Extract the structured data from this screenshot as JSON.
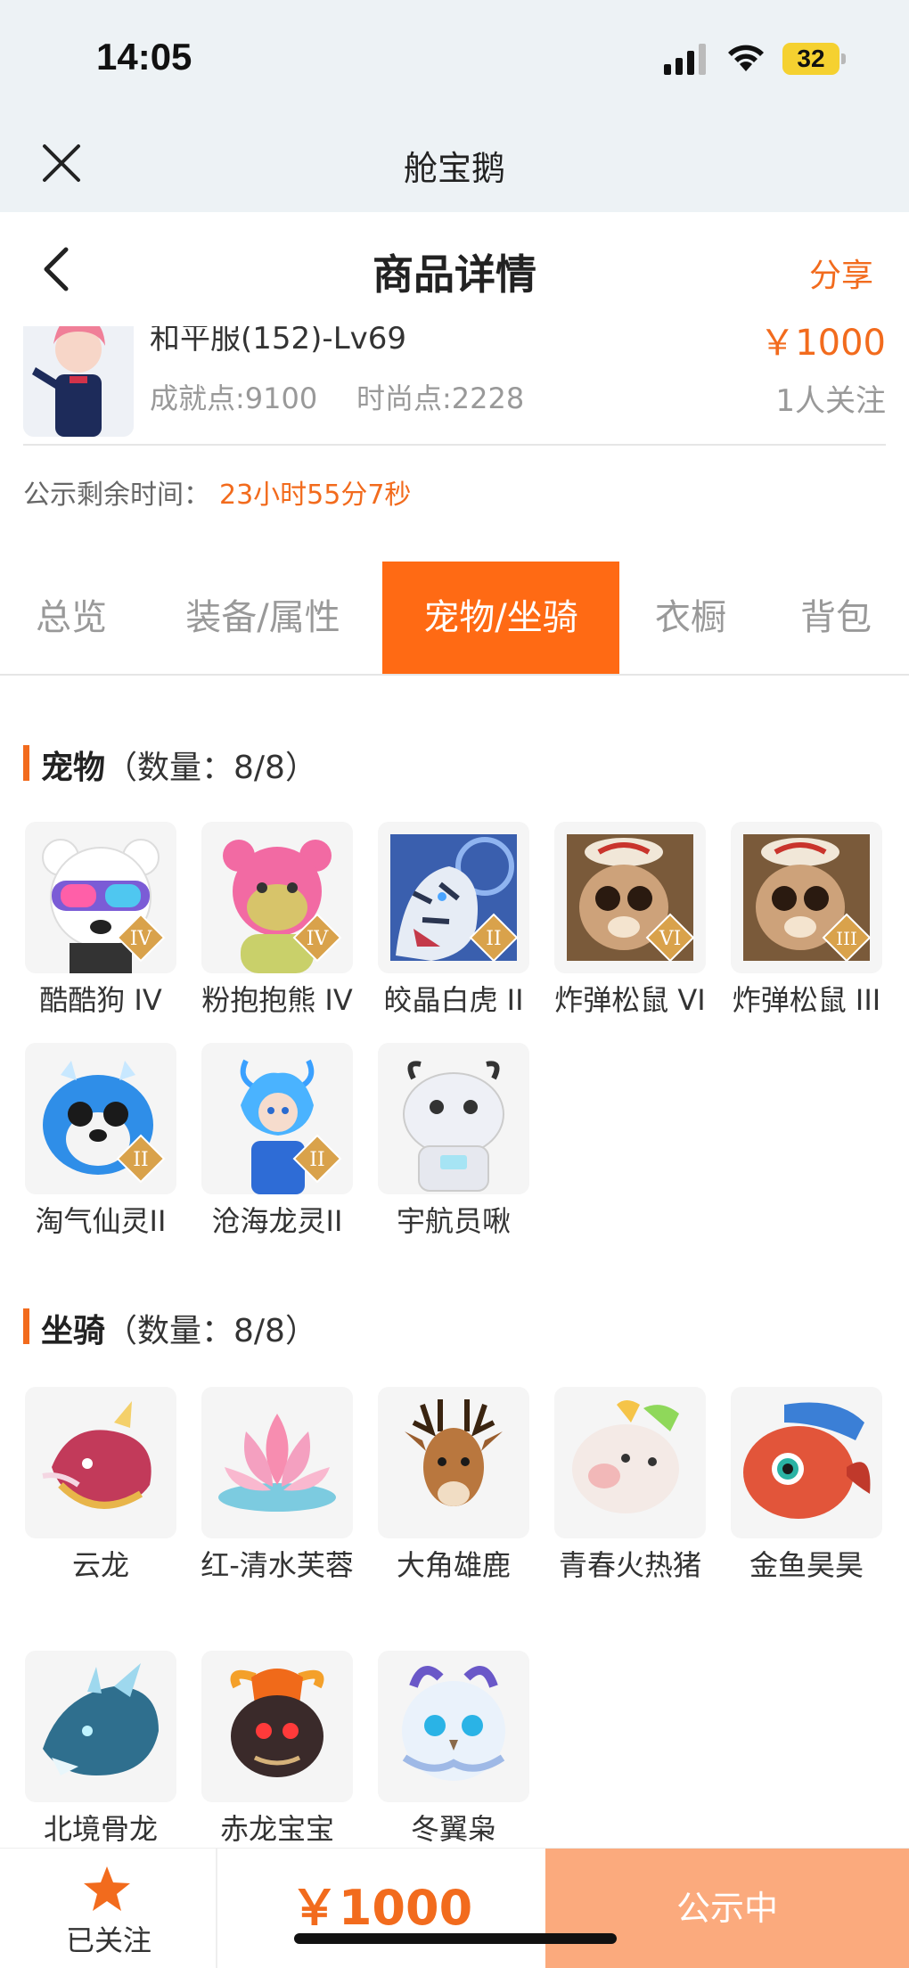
{
  "status_bar": {
    "time": "14:05",
    "battery": "32"
  },
  "mini_program": {
    "title": "舱宝鹅"
  },
  "nav": {
    "title": "商品详情",
    "share": "分享"
  },
  "product": {
    "server_level": "和平服(152)-Lv69",
    "achievement": "成就点:9100",
    "fashion": "时尚点:2228",
    "price": "￥1000",
    "followers": "1人关注"
  },
  "notice": {
    "label": "公示剩余时间：",
    "remaining": "23小时55分7秒"
  },
  "tabs": [
    "总览",
    "装备/属性",
    "宠物/坐骑",
    "衣橱",
    "背包"
  ],
  "pets": {
    "title": "宠物",
    "count": "（数量：8/8）",
    "items": [
      {
        "name": "酷酷狗 IV",
        "badge": "IV",
        "icon": "dog-goggles-icon"
      },
      {
        "name": "粉抱抱熊 IV",
        "badge": "IV",
        "icon": "pink-bear-icon"
      },
      {
        "name": "皎晶白虎 II",
        "badge": "II",
        "icon": "white-tiger-icon"
      },
      {
        "name": "炸弹松鼠 VI",
        "badge": "VI",
        "icon": "bomb-squirrel-icon"
      },
      {
        "name": "炸弹松鼠 III",
        "badge": "III",
        "icon": "bomb-squirrel-icon"
      },
      {
        "name": "淘气仙灵II",
        "badge": "II",
        "icon": "blue-puppy-icon"
      },
      {
        "name": "沧海龙灵II",
        "badge": "II",
        "icon": "dragon-spirit-icon"
      },
      {
        "name": "宇航员啾",
        "badge": "",
        "icon": "astronaut-robot-icon"
      }
    ]
  },
  "mounts": {
    "title": "坐骑",
    "count": "（数量：8/8）",
    "items": [
      {
        "name": "云龙",
        "icon": "cloud-dragon-icon"
      },
      {
        "name": "红-清水芙蓉",
        "icon": "lotus-icon"
      },
      {
        "name": "大角雄鹿",
        "icon": "stag-icon"
      },
      {
        "name": "青春火热猪",
        "icon": "pig-icon"
      },
      {
        "name": "金鱼昊昊",
        "icon": "goldfish-icon"
      },
      {
        "name": "北境骨龙",
        "icon": "bone-dragon-icon"
      },
      {
        "name": "赤龙宝宝",
        "icon": "red-dragon-icon"
      },
      {
        "name": "冬翼枭",
        "icon": "owl-icon"
      }
    ]
  },
  "bottom": {
    "follow": "已关注",
    "price": "￥1000",
    "status": "公示中"
  },
  "colors": {
    "accent": "#f26b1d",
    "tab_active": "#ff6a14",
    "status_btn": "#fbaa7d"
  }
}
